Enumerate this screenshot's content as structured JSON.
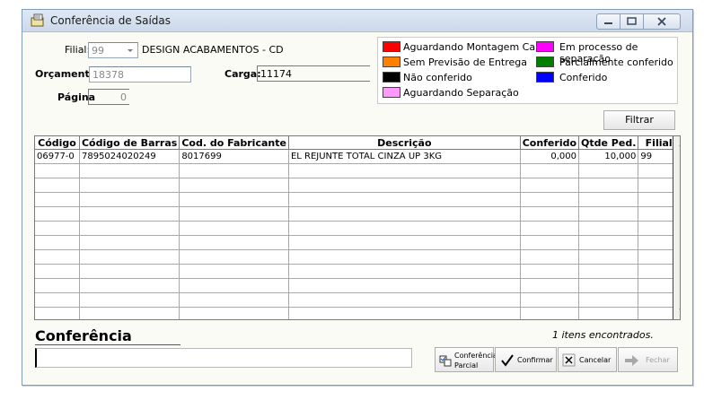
{
  "window": {
    "title": "Conferência de Saídas"
  },
  "filters": {
    "filial_label": "Filial:",
    "filial_value": "99",
    "filial_name": "DESIGN ACABAMENTOS - CD",
    "orcamento_label": "Orçamento:",
    "orcamento_value": "18378",
    "carga_label": "Carga:",
    "carga_value": "11174",
    "pagina_label": "Página",
    "pagina_value": "0"
  },
  "legend": [
    {
      "label": "Aguardando Montagem Carga",
      "color": "#ff0000"
    },
    {
      "label": "Sem Previsão de Entrega",
      "color": "#ff8000"
    },
    {
      "label": "Não conferido",
      "color": "#000000"
    },
    {
      "label": "Aguardando Separação",
      "color": "#ff99ff"
    },
    {
      "label": "Em processo de separação",
      "color": "#ff00ff"
    },
    {
      "label": "Parcialmente conferido",
      "color": "#008000"
    },
    {
      "label": "Conferido",
      "color": "#0000ff"
    }
  ],
  "filter_button": "Filtrar",
  "table": {
    "columns": [
      "Código",
      "Código de Barras",
      "Cod. do Fabricante",
      "Descrição",
      "Conferido",
      "Qtde Ped.",
      "Filial"
    ],
    "rows": [
      [
        "06977-0",
        "7895024020249",
        "8017699",
        "EL REJUNTE TOTAL CINZA UP 3KG",
        "0,000",
        "10,000",
        "99"
      ]
    ]
  },
  "conferencia": {
    "title": "Conferência",
    "input_value": "",
    "found_text": "1 itens encontrados."
  },
  "actions": {
    "partial_line1": "Conferência",
    "partial_line2": "Parcial",
    "confirm": "Confirmar",
    "cancel": "Cancelar",
    "close": "Fechar"
  }
}
